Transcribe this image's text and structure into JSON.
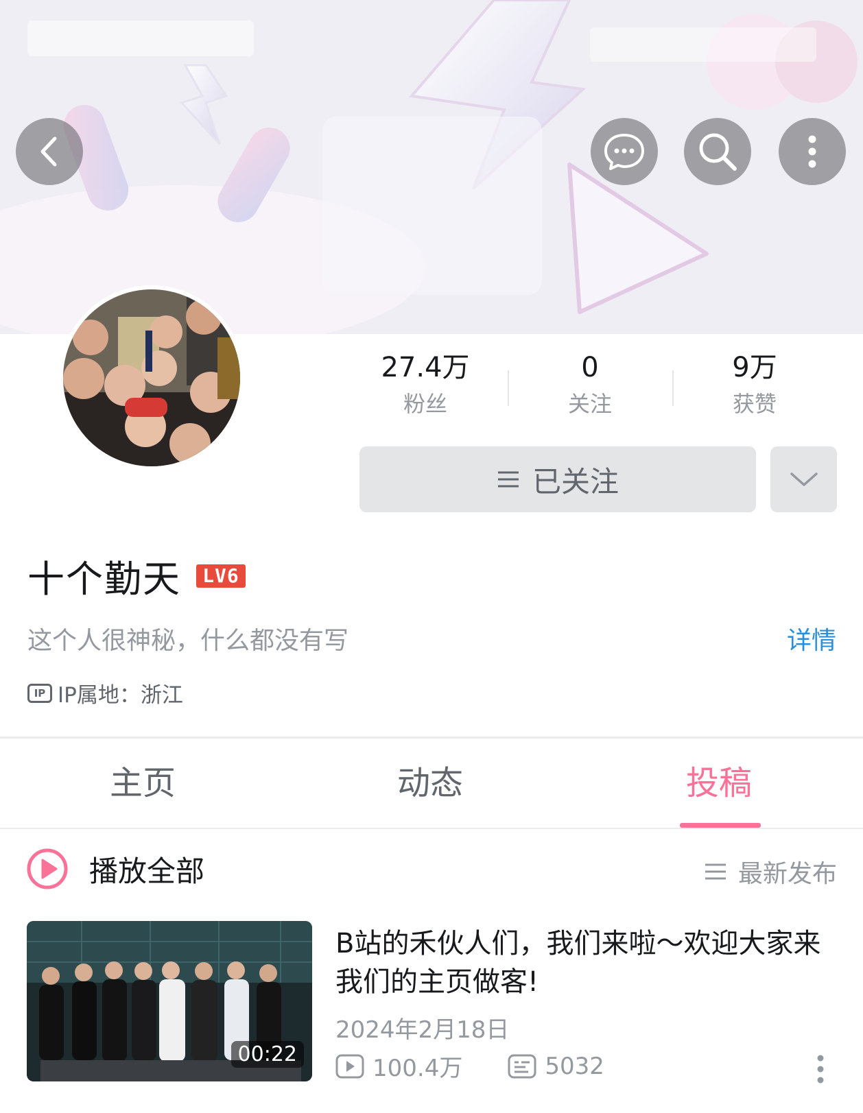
{
  "nav": {
    "back_icon": "chevron-left-icon",
    "message_icon": "chat-bubble-icon",
    "search_icon": "search-icon",
    "more_icon": "more-vertical-icon"
  },
  "stats": [
    {
      "value": "27.4万",
      "label": "粉丝"
    },
    {
      "value": "0",
      "label": "关注"
    },
    {
      "value": "9万",
      "label": "获赞"
    }
  ],
  "follow": {
    "label": "已关注"
  },
  "profile": {
    "name": "十个勤天",
    "level": "LV6",
    "bio": "这个人很神秘，什么都没有写",
    "detail_link": "详情",
    "ip": "IP属地：浙江"
  },
  "tabs": [
    {
      "label": "主页",
      "active": false
    },
    {
      "label": "动态",
      "active": false
    },
    {
      "label": "投稿",
      "active": true
    }
  ],
  "list_header": {
    "play_all": "播放全部",
    "sort": "最新发布"
  },
  "video": {
    "title": "B站的禾伙人们，我们来啦～欢迎大家来我们的主页做客!",
    "duration": "00:22",
    "date": "2024年2月18日",
    "views": "100.4万",
    "comments": "5032"
  },
  "colors": {
    "accent_pink": "#fb7299",
    "link_blue": "#2a8fd8",
    "level_red": "#e84b3c"
  }
}
